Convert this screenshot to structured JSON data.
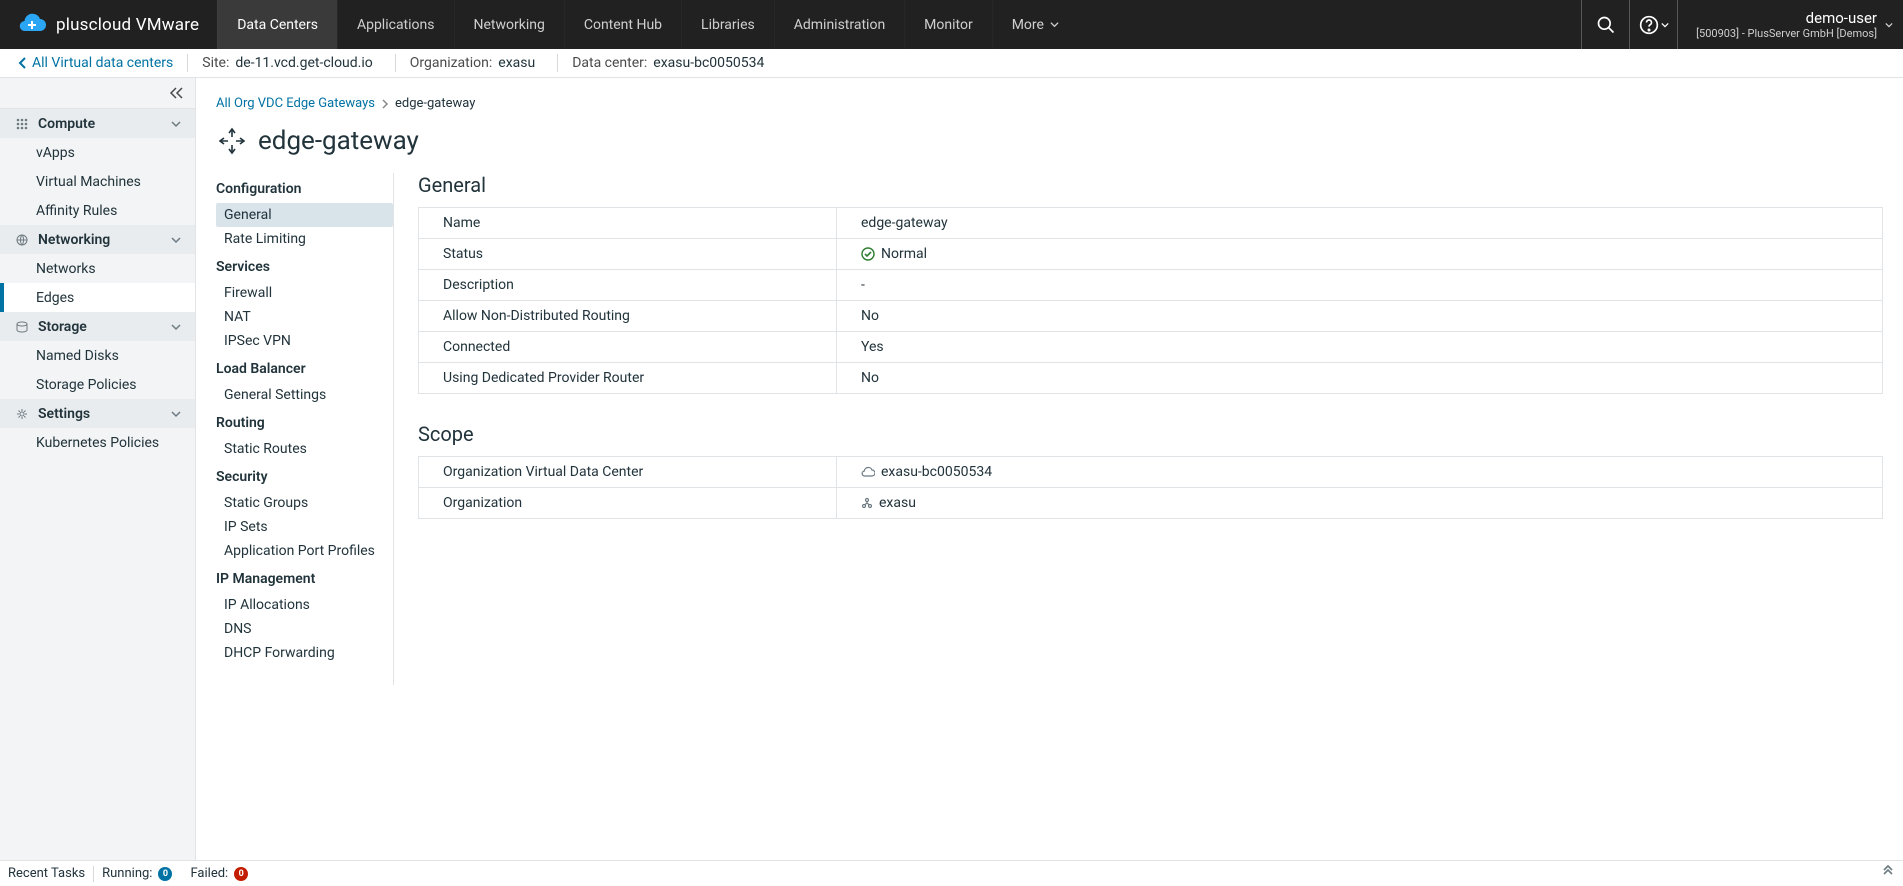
{
  "brand": "pluscloud VMware",
  "topTabs": [
    {
      "label": "Data Centers",
      "active": true
    },
    {
      "label": "Applications"
    },
    {
      "label": "Networking"
    },
    {
      "label": "Content Hub"
    },
    {
      "label": "Libraries"
    },
    {
      "label": "Administration"
    },
    {
      "label": "Monitor"
    },
    {
      "label": "More",
      "more": true
    }
  ],
  "user": {
    "name": "demo-user",
    "org": "[500903] - PlusServer GmbH [Demos]"
  },
  "context": {
    "back": "All Virtual data centers",
    "site_label": "Site:",
    "site": "de-11.vcd.get-cloud.io",
    "org_label": "Organization:",
    "org": "exasu",
    "dc_label": "Data center:",
    "dc": "exasu-bc0050534"
  },
  "sidebar": [
    {
      "type": "group",
      "label": "Compute",
      "icon": "grid"
    },
    {
      "type": "item",
      "label": "vApps"
    },
    {
      "type": "item",
      "label": "Virtual Machines"
    },
    {
      "type": "item",
      "label": "Affinity Rules"
    },
    {
      "type": "group",
      "label": "Networking",
      "icon": "globe"
    },
    {
      "type": "item",
      "label": "Networks"
    },
    {
      "type": "item",
      "label": "Edges",
      "active": true
    },
    {
      "type": "group",
      "label": "Storage",
      "icon": "disk"
    },
    {
      "type": "item",
      "label": "Named Disks"
    },
    {
      "type": "item",
      "label": "Storage Policies"
    },
    {
      "type": "group",
      "label": "Settings",
      "icon": "gear"
    },
    {
      "type": "item",
      "label": "Kubernetes Policies"
    }
  ],
  "breadcrumb": {
    "root": "All Org VDC Edge Gateways",
    "current": "edge-gateway"
  },
  "pageTitle": "edge-gateway",
  "detailNav": [
    {
      "head": "Configuration"
    },
    {
      "item": "General",
      "active": true
    },
    {
      "item": "Rate Limiting"
    },
    {
      "head": "Services"
    },
    {
      "item": "Firewall"
    },
    {
      "item": "NAT"
    },
    {
      "item": "IPSec VPN"
    },
    {
      "head": "Load Balancer"
    },
    {
      "item": "General Settings"
    },
    {
      "head": "Routing"
    },
    {
      "item": "Static Routes"
    },
    {
      "head": "Security"
    },
    {
      "item": "Static Groups"
    },
    {
      "item": "IP Sets"
    },
    {
      "item": "Application Port Profiles"
    },
    {
      "head": "IP Management"
    },
    {
      "item": "IP Allocations"
    },
    {
      "item": "DNS"
    },
    {
      "item": "DHCP Forwarding"
    }
  ],
  "general": {
    "title": "General",
    "rows": [
      {
        "k": "Name",
        "v": "edge-gateway"
      },
      {
        "k": "Status",
        "v": "Normal",
        "status": true
      },
      {
        "k": "Description",
        "v": "-"
      },
      {
        "k": "Allow Non-Distributed Routing",
        "v": "No"
      },
      {
        "k": "Connected",
        "v": "Yes"
      },
      {
        "k": "Using Dedicated Provider Router",
        "v": "No"
      }
    ]
  },
  "scope": {
    "title": "Scope",
    "rows": [
      {
        "k": "Organization Virtual Data Center",
        "v": "exasu-bc0050534",
        "icon": "cloud"
      },
      {
        "k": "Organization",
        "v": "exasu",
        "icon": "org"
      }
    ]
  },
  "footer": {
    "tasks": "Recent Tasks",
    "running": "Running:",
    "running_n": "0",
    "failed": "Failed:",
    "failed_n": "0"
  }
}
